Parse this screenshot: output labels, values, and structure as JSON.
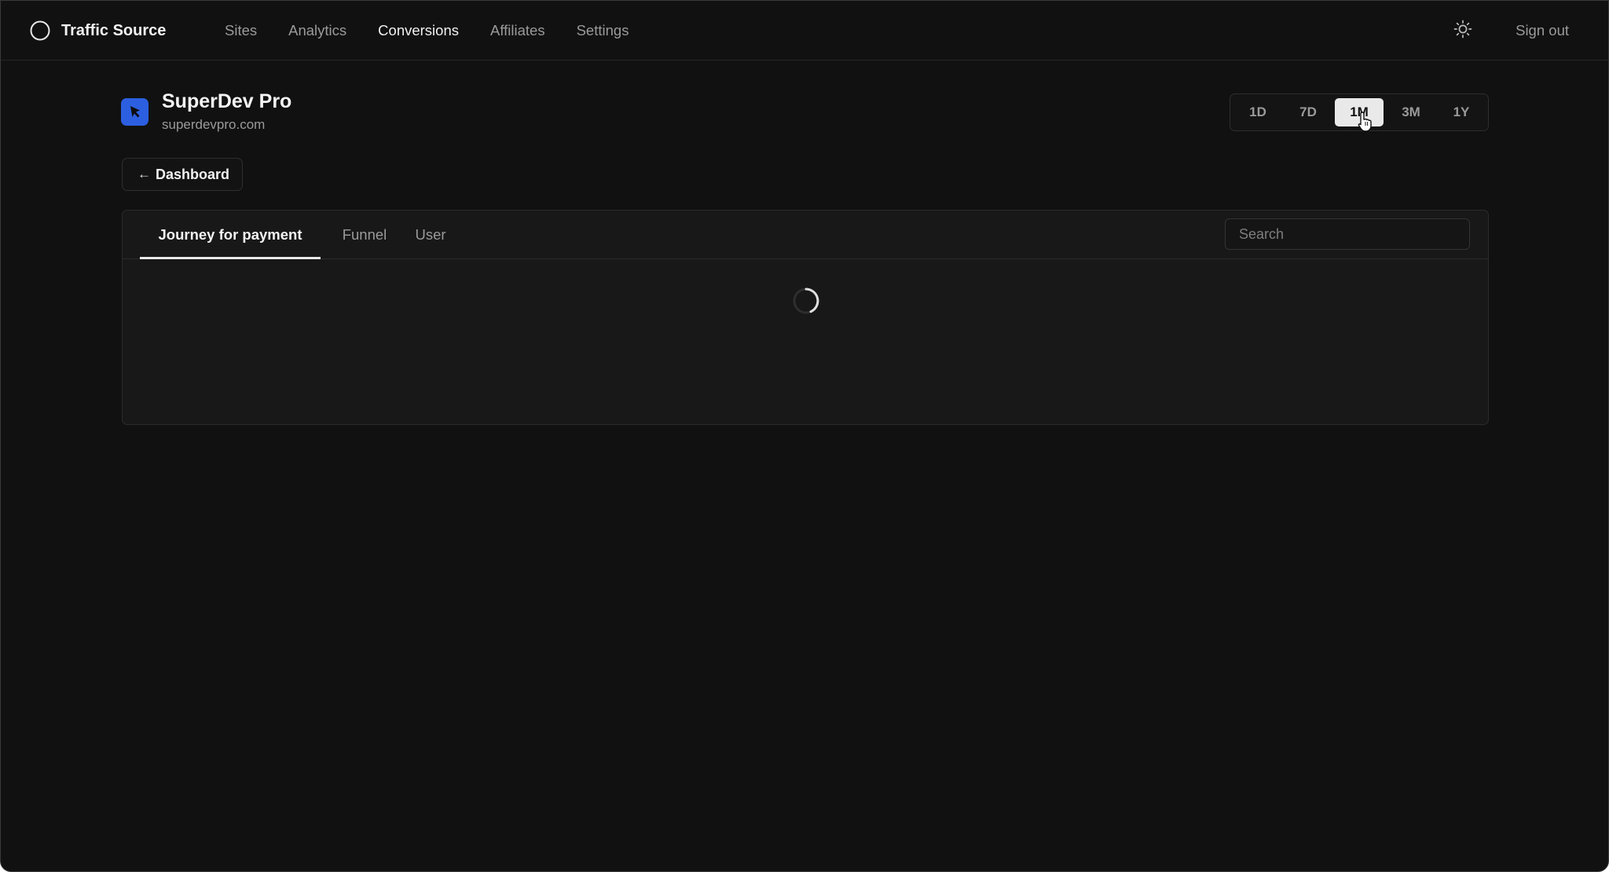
{
  "app": {
    "brand": "Traffic Source",
    "nav": [
      {
        "label": "Sites"
      },
      {
        "label": "Analytics"
      },
      {
        "label": "Conversions"
      },
      {
        "label": "Affiliates"
      },
      {
        "label": "Settings"
      }
    ],
    "active_nav": "Conversions",
    "sign_out": "Sign out",
    "theme_icon": "sun-icon"
  },
  "site": {
    "name": "SuperDev Pro",
    "domain": "superdevpro.com",
    "icon": "cursor-arrow-icon",
    "icon_color": "#2c5fe0"
  },
  "range": {
    "options": [
      "1D",
      "7D",
      "1M",
      "3M",
      "1Y"
    ],
    "selected": "1M"
  },
  "back": {
    "label": "Dashboard",
    "arrow": "←"
  },
  "panel": {
    "tabs": [
      {
        "label": "Journey for payment"
      },
      {
        "label": "Funnel"
      },
      {
        "label": "User"
      }
    ],
    "active_tab": "Journey for payment",
    "search": {
      "placeholder": "Search",
      "value": ""
    },
    "loading": true
  },
  "colors": {
    "background": "#111111",
    "card": "#181818",
    "accent": "#2c5fe0",
    "active_segment": "#e9e9e9"
  }
}
